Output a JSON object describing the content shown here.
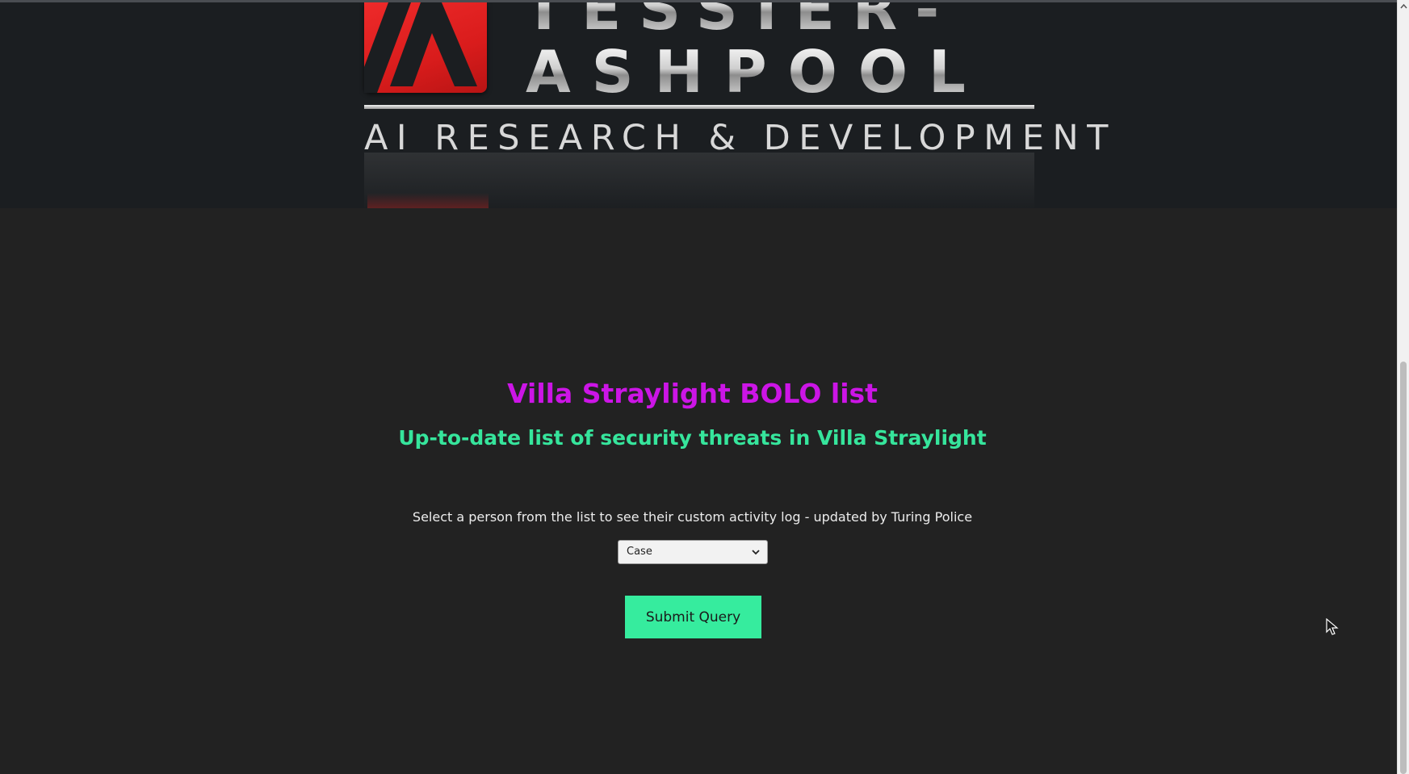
{
  "banner": {
    "logo_title_line1": "TESSIER-",
    "logo_title_line2": "ASHPOOL",
    "logo_subtitle": "AI RESEARCH  & DEVELOPMENT"
  },
  "main": {
    "title": "Villa Straylight BOLO list",
    "subtitle": "Up-to-date list of security threats in Villa Straylight",
    "instruction": "Select a person from the list to see their custom activity log - updated by Turing Police",
    "person_select": {
      "selected": "Case"
    },
    "submit_label": "Submit Query"
  },
  "colors": {
    "background": "#222222",
    "title": "#cc15e6",
    "subtitle": "#36e59c",
    "submit_button": "#36ec9e",
    "logo_red": "#e02020"
  },
  "icons": {
    "select_arrow": "chevron-down-icon",
    "scroll_up": "chevron-up-icon",
    "cursor": "mouse-pointer-icon"
  }
}
